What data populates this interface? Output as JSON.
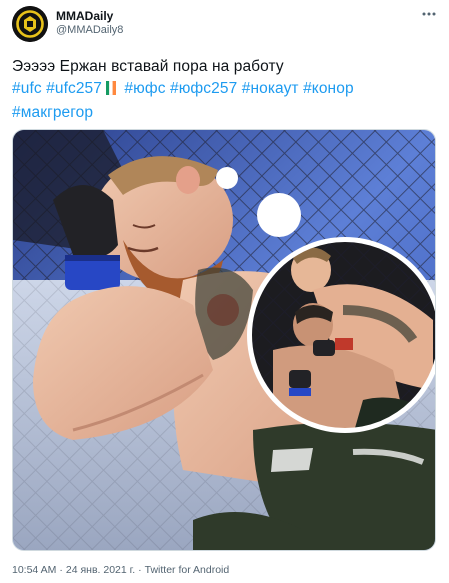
{
  "author": {
    "display_name": "MMADaily",
    "handle": "@MMADaily8"
  },
  "tweet": {
    "text_line1": "Эээээ Ержан вставай пора на работу",
    "hashtags_line2": [
      "#ufc",
      "#ufc257",
      "#юфс",
      "#юфс257",
      "#нокаут",
      "#конор"
    ],
    "hashtags_line3": [
      "#макгрегор"
    ]
  },
  "meta": {
    "time": "10:54 AM",
    "date": "24 янв. 2021 г.",
    "separator": "·",
    "source": "Twitter for Android"
  },
  "colors": {
    "link": "#1d9bf0",
    "secondary_text": "#536471",
    "border": "#cfd9de"
  },
  "icons": {
    "more": "more-options-icon",
    "flag": "ireland-flag-icon"
  }
}
